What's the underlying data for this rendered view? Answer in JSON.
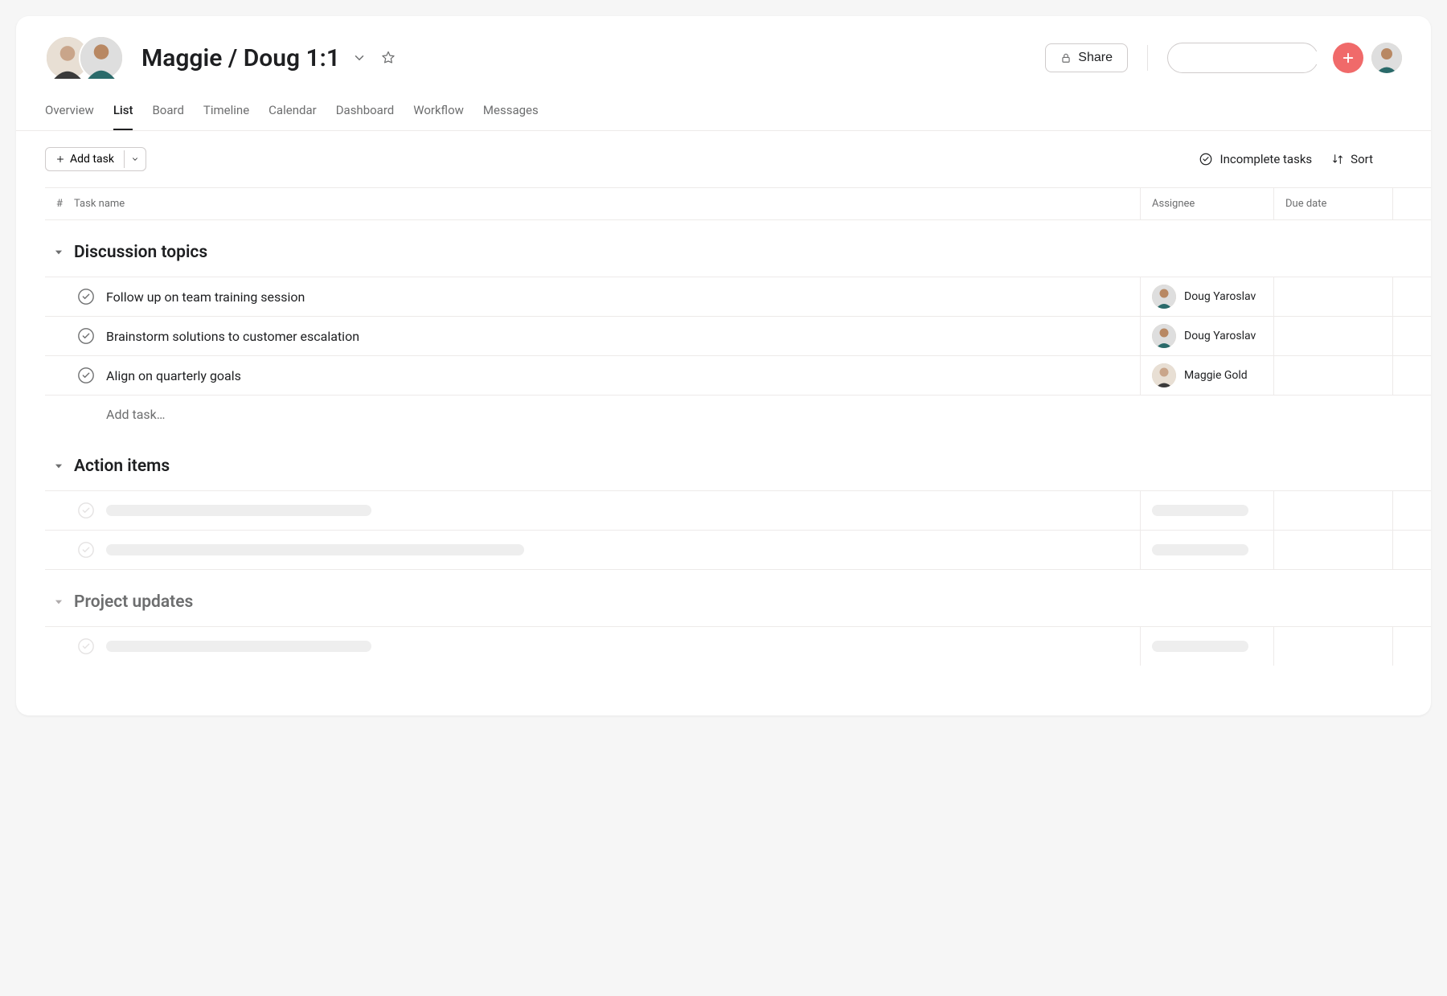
{
  "header": {
    "title": "Maggie / Doug 1:1",
    "share_label": "Share"
  },
  "tabs": [
    "Overview",
    "List",
    "Board",
    "Timeline",
    "Calendar",
    "Dashboard",
    "Workflow",
    "Messages"
  ],
  "active_tab": "List",
  "toolbar": {
    "add_task_label": "Add task",
    "filter_label": "Incomplete tasks",
    "sort_label": "Sort"
  },
  "columns": {
    "hash": "#",
    "name": "Task name",
    "assignee": "Assignee",
    "due": "Due date"
  },
  "sections": [
    {
      "title": "Discussion topics",
      "muted": false,
      "tasks": [
        {
          "name": "Follow up on team training session",
          "assignee": "Doug Yaroslav"
        },
        {
          "name": "Brainstorm solutions to customer escalation",
          "assignee": "Doug Yaroslav"
        },
        {
          "name": "Align on quarterly goals",
          "assignee": "Maggie Gold"
        }
      ],
      "add_task_placeholder": "Add task…",
      "placeholders": []
    },
    {
      "title": "Action items",
      "muted": false,
      "tasks": [],
      "placeholders": [
        "short",
        "long"
      ]
    },
    {
      "title": "Project updates",
      "muted": true,
      "tasks": [],
      "placeholders": [
        "short"
      ]
    }
  ]
}
